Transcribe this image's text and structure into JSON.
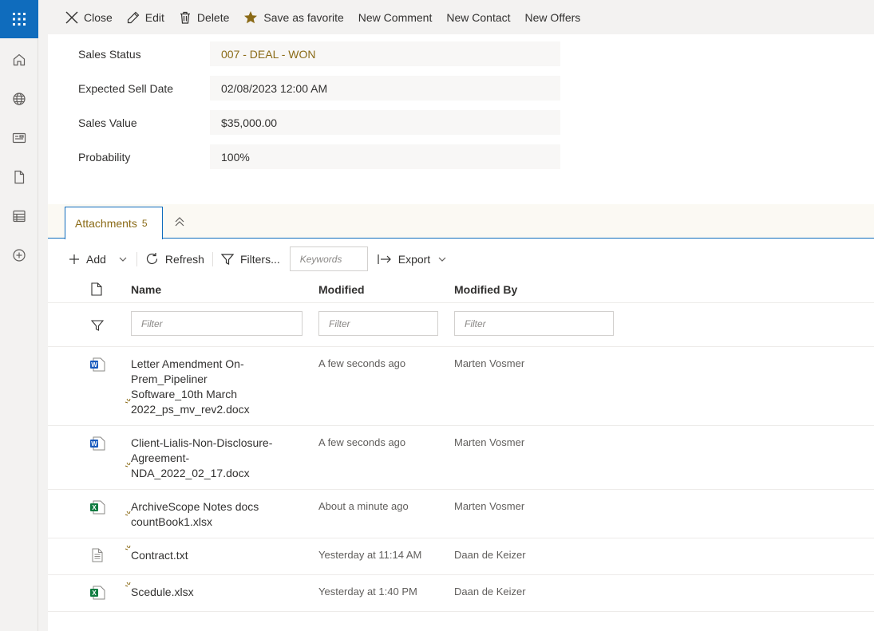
{
  "rail": {
    "icons": [
      "waffle-icon",
      "home-icon",
      "globe-icon",
      "news-icon",
      "document-icon",
      "list-icon",
      "add-circle-icon"
    ]
  },
  "commandbar": {
    "close": "Close",
    "edit": "Edit",
    "delete": "Delete",
    "favorite": "Save as favorite",
    "new_comment": "New Comment",
    "new_contact": "New Contact",
    "new_offers": "New Offers"
  },
  "form": {
    "fields": [
      {
        "label": "Sales Status",
        "value": "007 - DEAL - WON"
      },
      {
        "label": "Expected Sell Date",
        "value": "02/08/2023 12:00 AM"
      },
      {
        "label": "Sales Value",
        "value": "$35,000.00"
      },
      {
        "label": "Probability",
        "value": "100%"
      }
    ]
  },
  "attachments": {
    "tab_label": "Attachments",
    "count": "5",
    "toolbar": {
      "add": "Add",
      "refresh": "Refresh",
      "filters": "Filters...",
      "keywords_placeholder": "Keywords",
      "export": "Export"
    },
    "columns": {
      "name": "Name",
      "modified": "Modified",
      "modified_by": "Modified By"
    },
    "filter_placeholder": "Filter",
    "rows": [
      {
        "name": "Letter Amendment On-\nPrem_Pipeliner\nSoftware_10th March\n2022_ps_mv_rev2.docx",
        "modified": "A few seconds ago",
        "modified_by": "Marten Vosmer",
        "type": "word"
      },
      {
        "name": "Client-Lialis-Non-Disclosure-\nAgreement-\nNDA_2022_02_17.docx",
        "modified": "A few seconds ago",
        "modified_by": "Marten Vosmer",
        "type": "word"
      },
      {
        "name": "ArchiveScope Notes docs\ncountBook1.xlsx",
        "modified": "About a minute ago",
        "modified_by": "Marten Vosmer",
        "type": "excel"
      },
      {
        "name": "Contract.txt",
        "modified": "Yesterday at 11:14 AM",
        "modified_by": "Daan de Keizer",
        "type": "text"
      },
      {
        "name": "Scedule.xlsx",
        "modified": "Yesterday at 1:40 PM",
        "modified_by": "Daan de Keizer",
        "type": "excel"
      }
    ]
  },
  "colors": {
    "accent": "#0f6cbd",
    "gold": "#8a6a16",
    "word": "#185abd",
    "excel": "#107c41"
  }
}
